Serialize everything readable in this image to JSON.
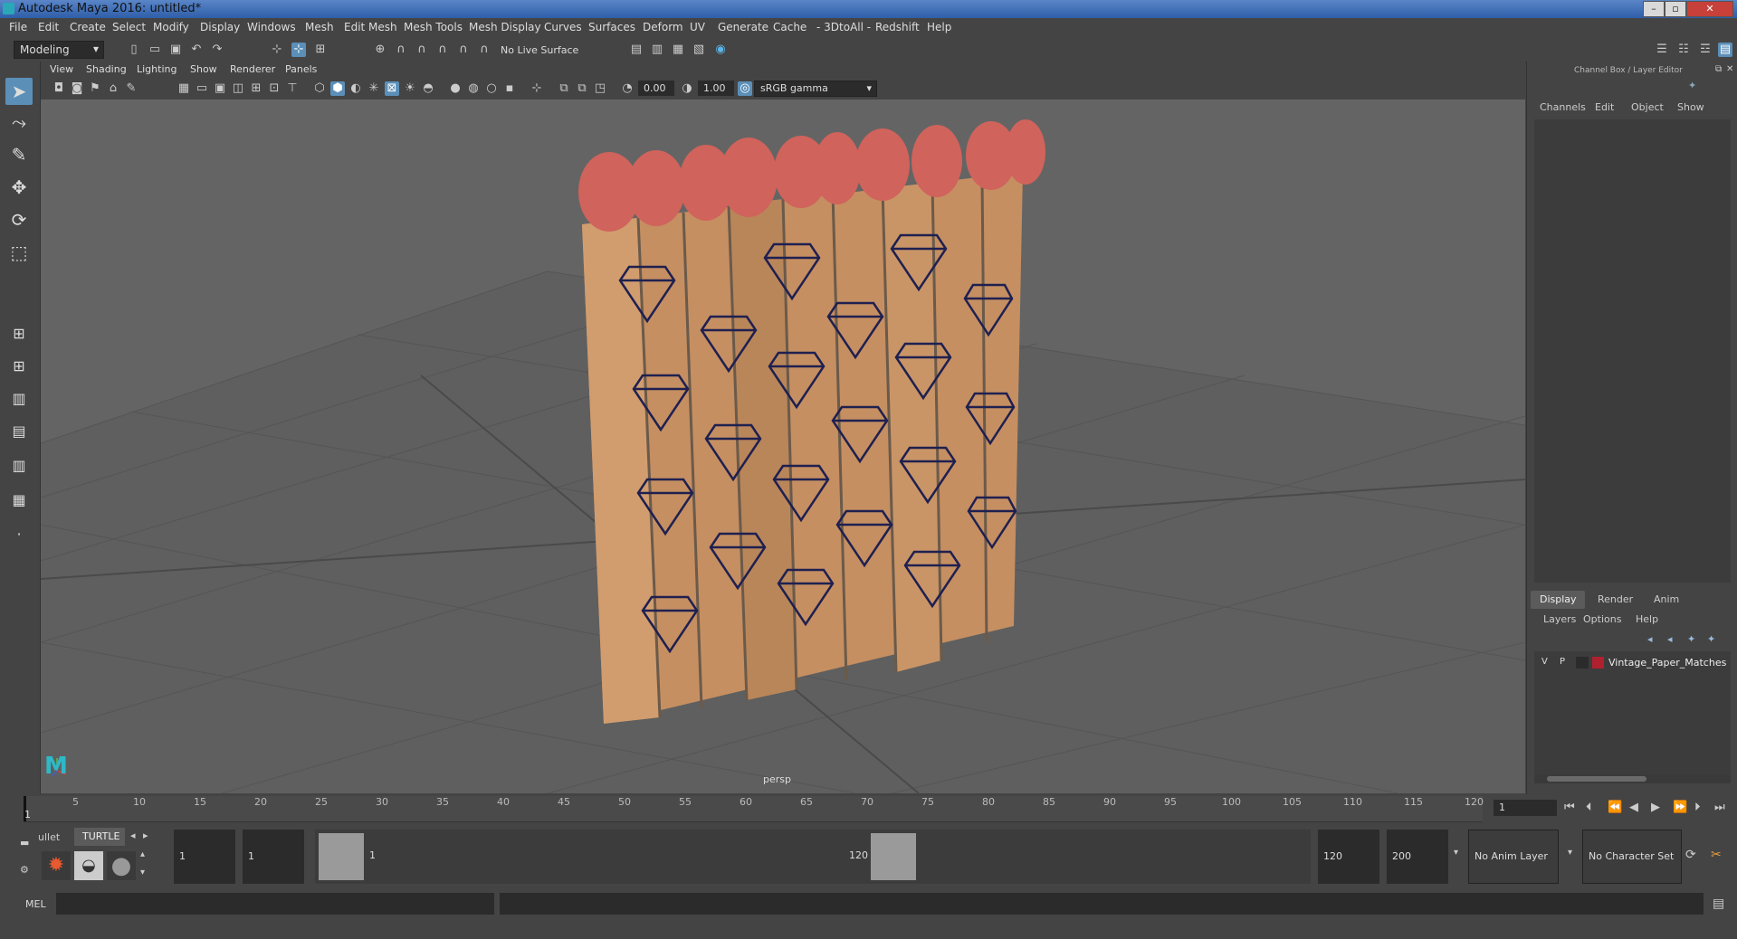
{
  "title": "Autodesk Maya 2016: untitled*",
  "window_buttons": [
    "–",
    "▫",
    "✕"
  ],
  "menus": [
    "File",
    "Edit",
    "Create",
    "Select",
    "Modify",
    "Display",
    "Windows",
    "Mesh",
    "Edit Mesh",
    "Mesh Tools",
    "Mesh Display",
    "Curves",
    "Surfaces",
    "Deform",
    "UV",
    "Generate",
    "Cache",
    "- 3DtoAll -",
    "Redshift",
    "Help"
  ],
  "mode": "Modeling",
  "live_surface": "No Live Surface",
  "panel_menus": [
    "View",
    "Shading",
    "Lighting",
    "Show",
    "Renderer",
    "Panels"
  ],
  "exposure": "0.00",
  "gamma": "1.00",
  "colorspace": "sRGB gamma",
  "camera": "persp",
  "right_panel": {
    "header": "Channel Box / Layer Editor",
    "channel_menus": [
      "Channels",
      "Edit",
      "Object",
      "Show"
    ],
    "tabs": [
      "Display",
      "Render",
      "Anim"
    ],
    "layer_menus": [
      "Layers",
      "Options",
      "Help"
    ],
    "layer": {
      "v": "V",
      "p": "P",
      "name": "Vintage_Paper_Matches",
      "color": "#b0202f"
    }
  },
  "timeline": {
    "ticks": [
      "5",
      "10",
      "15",
      "20",
      "25",
      "30",
      "35",
      "40",
      "45",
      "50",
      "55",
      "60",
      "65",
      "70",
      "75",
      "80",
      "85",
      "90",
      "95",
      "100",
      "105",
      "110",
      "115",
      "120"
    ],
    "start_mark": "1",
    "current_frame": "1"
  },
  "range": {
    "start": "1",
    "playback_start": "1",
    "slider_start": "1",
    "slider_end": "120",
    "playback_end": "120",
    "end": "200",
    "anim_layer": "No Anim Layer",
    "char_set": "No Character Set"
  },
  "shelf_tabs": [
    "ullet",
    "TURTLE"
  ],
  "cmd_label": "MEL"
}
